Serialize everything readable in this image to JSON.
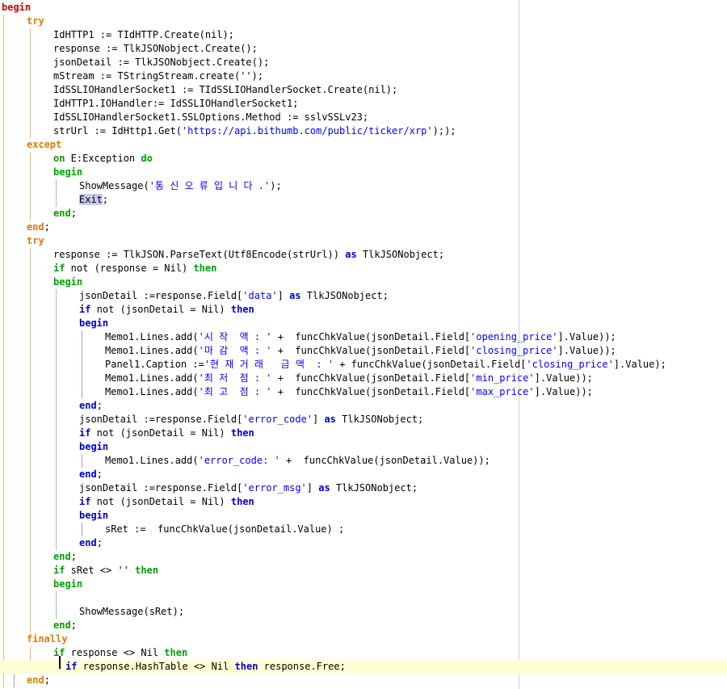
{
  "editor": {
    "lines": [
      [
        [
          "kw-begin",
          "begin"
        ]
      ],
      [
        [
          "kw-try",
          "try"
        ]
      ],
      [
        [
          "",
          "IdHTTP1 := TIdHTTP.Create(nil);"
        ]
      ],
      [
        [
          "",
          "response := TlkJSONobject.Create();"
        ]
      ],
      [
        [
          "",
          "jsonDetail := TlkJSONobject.Create();"
        ]
      ],
      [
        [
          "",
          "mStream := TStringStream.create('');"
        ]
      ],
      [
        [
          "",
          "IdSSLIOHandlerSocket1 := TIdSSLIOHandlerSocket.Create(nil);"
        ]
      ],
      [
        [
          "",
          "IdHTTP1.IOHandler:= IdSSLIOHandlerSocket1;"
        ]
      ],
      [
        [
          "",
          "IdSSLIOHandlerSocket1.SSLOptions.Method := sslvSSLv23;"
        ]
      ],
      [
        [
          "",
          "strUrl := IdHttp1.Get("
        ],
        [
          "str",
          "'https://api.bithumb.com/public/ticker/xrp'"
        ],
        [
          "",
          "););"
        ]
      ],
      [
        [
          "kw-try",
          "except"
        ]
      ],
      [
        [
          "kw-green",
          "on"
        ],
        [
          "",
          " E:Exception "
        ],
        [
          "kw-green",
          "do"
        ]
      ],
      [
        [
          "kw-green",
          "begin"
        ]
      ],
      [
        [
          "",
          "ShowMessage("
        ],
        [
          "str",
          "'통 신 오 류 입 니 다 .'"
        ],
        [
          "",
          ");"
        ]
      ],
      [
        [
          "hl",
          "Exit"
        ],
        [
          "",
          ";"
        ]
      ],
      [
        [
          "kw-green",
          "end"
        ],
        [
          "",
          ";"
        ]
      ],
      [
        [
          "kw-try",
          "end"
        ],
        [
          "",
          ";"
        ]
      ],
      [
        [
          "kw-try",
          "try"
        ]
      ],
      [
        [
          "",
          "response := TlkJSON.ParseText(Utf8Encode(strUrl)) "
        ],
        [
          "kw-blue",
          "as"
        ],
        [
          "",
          " TlkJSONobject;"
        ]
      ],
      [
        [
          "kw-green",
          "if"
        ],
        [
          "",
          " not (response = Nil) "
        ],
        [
          "kw-green",
          "then"
        ]
      ],
      [
        [
          "kw-green",
          "begin"
        ]
      ],
      [
        [
          "",
          "jsonDetail :=response.Field["
        ],
        [
          "str",
          "'data'"
        ],
        [
          "",
          "] "
        ],
        [
          "kw-blue",
          "as"
        ],
        [
          "",
          " TlkJSONobject;"
        ]
      ],
      [
        [
          "kw-blue",
          "if"
        ],
        [
          "",
          " not (jsonDetail = Nil) "
        ],
        [
          "kw-blue",
          "then"
        ]
      ],
      [
        [
          "kw-blue",
          "begin"
        ]
      ],
      [
        [
          "",
          "Memo1.Lines.add("
        ],
        [
          "str",
          "'시 작  액 : '"
        ],
        [
          "",
          " +  funcChkValue(jsonDetail.Field["
        ],
        [
          "str",
          "'opening_price'"
        ],
        [
          "",
          "].Value));"
        ]
      ],
      [
        [
          "",
          "Memo1.Lines.add("
        ],
        [
          "str",
          "'마 감  액 : '"
        ],
        [
          "",
          " +  funcChkValue(jsonDetail.Field["
        ],
        [
          "str",
          "'closing_price'"
        ],
        [
          "",
          "].Value));"
        ]
      ],
      [
        [
          "",
          "Panel1.Caption :="
        ],
        [
          "str",
          "'현 재 거 래   금 액  : '"
        ],
        [
          "",
          " + funcChkValue(jsonDetail.Field["
        ],
        [
          "str",
          "'closing_price'"
        ],
        [
          "",
          "].Value);"
        ]
      ],
      [
        [
          "",
          "Memo1.Lines.add("
        ],
        [
          "str",
          "'최 저  점 : '"
        ],
        [
          "",
          " +  funcChkValue(jsonDetail.Field["
        ],
        [
          "str",
          "'min_price'"
        ],
        [
          "",
          "].Value));"
        ]
      ],
      [
        [
          "",
          "Memo1.Lines.add("
        ],
        [
          "str",
          "'최 고  점 : '"
        ],
        [
          "",
          " +  funcChkValue(jsonDetail.Field["
        ],
        [
          "str",
          "'max_price'"
        ],
        [
          "",
          "].Value));"
        ]
      ],
      [
        [
          "kw-blue",
          "end"
        ],
        [
          "",
          ";"
        ]
      ],
      [
        [
          "",
          "jsonDetail :=response.Field["
        ],
        [
          "str",
          "'error_code'"
        ],
        [
          "",
          "] "
        ],
        [
          "kw-blue",
          "as"
        ],
        [
          "",
          " TlkJSONobject;"
        ]
      ],
      [
        [
          "kw-blue",
          "if"
        ],
        [
          "",
          " not (jsonDetail = Nil) "
        ],
        [
          "kw-blue",
          "then"
        ]
      ],
      [
        [
          "kw-blue",
          "begin"
        ]
      ],
      [
        [
          "",
          "Memo1.Lines.add("
        ],
        [
          "str",
          "'error_code: '"
        ],
        [
          "",
          " +  funcChkValue(jsonDetail.Value));"
        ]
      ],
      [
        [
          "kw-blue",
          "end"
        ],
        [
          "",
          ";"
        ]
      ],
      [
        [
          "",
          "jsonDetail :=response.Field["
        ],
        [
          "str",
          "'error_msg'"
        ],
        [
          "",
          "] "
        ],
        [
          "kw-blue",
          "as"
        ],
        [
          "",
          " TlkJSONobject;"
        ]
      ],
      [
        [
          "kw-blue",
          "if"
        ],
        [
          "",
          " not (jsonDetail = Nil) "
        ],
        [
          "kw-blue",
          "then"
        ]
      ],
      [
        [
          "kw-blue",
          "begin"
        ]
      ],
      [
        [
          "",
          "sRet :=  funcChkValue(jsonDetail.Value) ;"
        ]
      ],
      [
        [
          "kw-blue",
          "end"
        ],
        [
          "",
          ";"
        ]
      ],
      [
        [
          "kw-green",
          "end"
        ],
        [
          "",
          ";"
        ]
      ],
      [
        [
          "kw-green",
          "if"
        ],
        [
          "",
          " sRet <> '' "
        ],
        [
          "kw-green",
          "then"
        ]
      ],
      [
        [
          "kw-green",
          "begin"
        ]
      ],
      [],
      [
        [
          "",
          "ShowMessage(sRet);"
        ]
      ],
      [
        [
          "kw-green",
          "end"
        ],
        [
          "",
          ";"
        ]
      ],
      [
        [
          "kw-try",
          "finally"
        ]
      ],
      [
        [
          "kw-green",
          "if"
        ],
        [
          "",
          " response <> Nil "
        ],
        [
          "kw-green",
          "then"
        ]
      ],
      [
        [
          "kw-blue",
          "if"
        ],
        [
          "",
          " response.HashTable <> Nil "
        ],
        [
          "kw-blue",
          "then"
        ],
        [
          "",
          " response.Free;"
        ]
      ],
      [
        [
          "kw-try",
          "end"
        ],
        [
          "",
          ";"
        ]
      ]
    ]
  }
}
